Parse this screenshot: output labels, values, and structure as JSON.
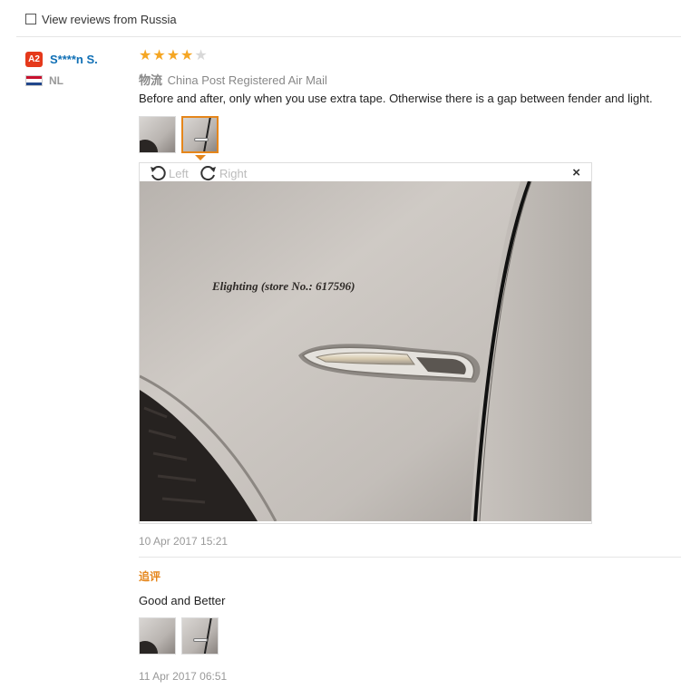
{
  "filter": {
    "label": "View reviews from Russia",
    "checked": false
  },
  "review": {
    "level_badge": "A2",
    "username": "S****n S.",
    "country_code": "NL",
    "flag_colors": [
      "#c8102e",
      "#ffffff",
      "#21468b"
    ],
    "rating": 4,
    "rating_max": 5,
    "logistics_tag": "物流",
    "logistics_method": "China Post Registered Air Mail",
    "text": "Before and after, only when you use extra tape. Otherwise there is a gap between fender and light.",
    "thumbnails": [
      {
        "icon": "photo-thumbnail",
        "active": false
      },
      {
        "icon": "photo-thumbnail",
        "active": true
      }
    ],
    "viewer": {
      "rotate_left_label": "Left",
      "rotate_right_label": "Right",
      "close_icon": "×",
      "watermark": "Elighting (store No.: 617596)"
    },
    "date": "10 Apr 2017 15:21"
  },
  "followup": {
    "tag": "追评",
    "text": "Good and Better",
    "thumbnails": [
      {
        "icon": "photo-thumbnail"
      },
      {
        "icon": "photo-thumbnail"
      }
    ],
    "date": "11 Apr 2017 06:51"
  },
  "colors": {
    "accent": "#e5861b",
    "star": "#f5a623",
    "username": "#0f6fb5",
    "badge": "#e5391b"
  }
}
